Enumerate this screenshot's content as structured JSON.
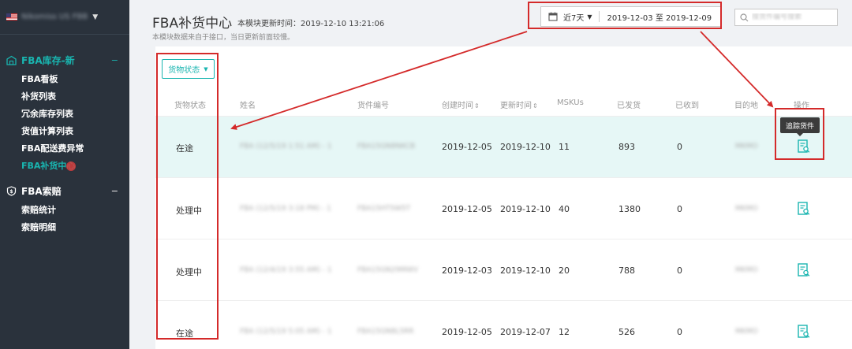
{
  "sidebar": {
    "store_name": "Nikomiss US FBB",
    "groups": [
      {
        "label": "FBA库存-新",
        "toggle": "−",
        "items": [
          "FBA看板",
          "补货列表",
          "冗余库存列表",
          "货值计算列表",
          "FBA配送费异常",
          "FBA补货中心"
        ]
      },
      {
        "label": "FBA索赔",
        "toggle": "−",
        "items": [
          "索赔统计",
          "索赔明细"
        ]
      }
    ]
  },
  "header": {
    "title": "FBA补货中心",
    "update_time": "本模块更新时间：2019-12-10 13:21:06",
    "desc": "本模块数据来自于接口，当日更新前面较慢。"
  },
  "date_filter": {
    "quick": "近7天",
    "range": "2019-12-03 至 2019-12-09"
  },
  "search": {
    "placeholder": "搜货件编号搜索"
  },
  "filter_button": "货物状态",
  "table": {
    "columns": [
      "货物状态",
      "姓名",
      "货件编号",
      "创建时间",
      "更新时间",
      "MSKUs",
      "已发货",
      "已收到",
      "目的地",
      "操作"
    ],
    "rows": [
      {
        "status": "在途",
        "name": "FBA (12/5/19 1:51 AM) - 1",
        "shipment_id": "FBA15GN8NKCB",
        "created": "2019-12-05",
        "updated": "2019-12-10",
        "mskus": "11",
        "shipped": "893",
        "received": "0",
        "destination": "MKMO"
      },
      {
        "status": "处理中",
        "name": "FBA (12/5/19 3:18 PM) - 1",
        "shipment_id": "FBA15HT5W5T",
        "created": "2019-12-05",
        "updated": "2019-12-10",
        "mskus": "40",
        "shipped": "1380",
        "received": "0",
        "destination": "MKMO"
      },
      {
        "status": "处理中",
        "name": "FBA (12/4/19 3:55 AM) - 1",
        "shipment_id": "FBA15GN29MWV",
        "created": "2019-12-03",
        "updated": "2019-12-10",
        "mskus": "20",
        "shipped": "788",
        "received": "0",
        "destination": "MKMO"
      },
      {
        "status": "在途",
        "name": "FBA (12/5/19 5:05 AM) - 1",
        "shipment_id": "FBA15GN8L5RR",
        "created": "2019-12-05",
        "updated": "2019-12-07",
        "mskus": "12",
        "shipped": "526",
        "received": "0",
        "destination": "MKMO"
      }
    ]
  },
  "tooltip": "追踪货件",
  "colors": {
    "accent": "#19b5b0",
    "sidebar_bg": "#2a323c",
    "annotation_red": "#d42a2a",
    "highlight_row": "#e6f7f6"
  }
}
